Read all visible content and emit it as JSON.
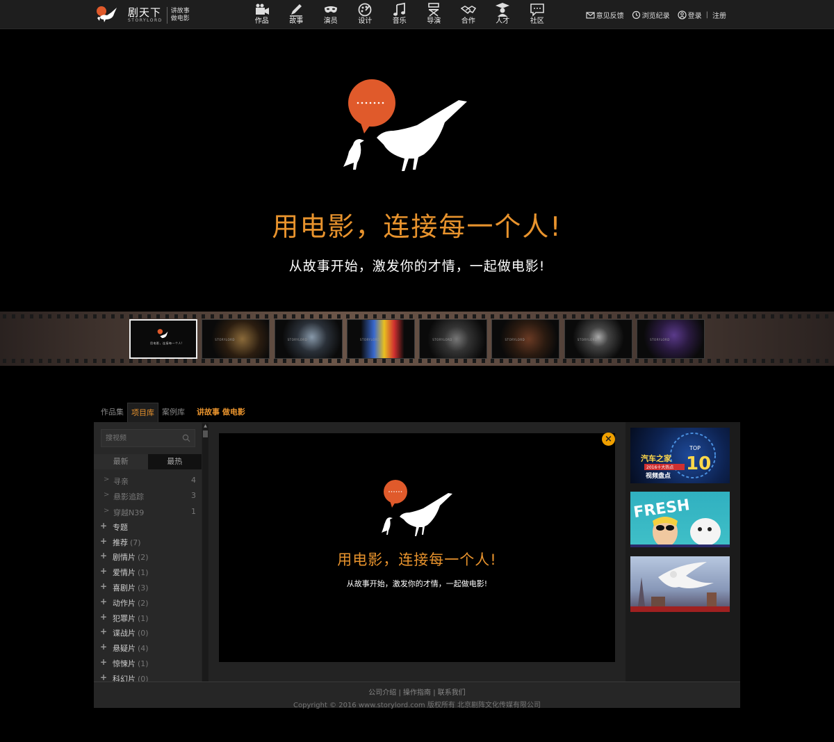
{
  "logo": {
    "cn": "剧天下",
    "en": "STORYLORD",
    "slogan_line1": "讲故事",
    "slogan_line2": "做电影"
  },
  "nav": [
    {
      "label": "作品",
      "icon": "video-camera-icon"
    },
    {
      "label": "故事",
      "icon": "pencil-icon"
    },
    {
      "label": "演员",
      "icon": "mask-icon"
    },
    {
      "label": "设计",
      "icon": "palette-icon"
    },
    {
      "label": "音乐",
      "icon": "music-note-icon"
    },
    {
      "label": "导演",
      "icon": "director-chair-icon"
    },
    {
      "label": "合作",
      "icon": "handshake-icon"
    },
    {
      "label": "人才",
      "icon": "graduate-icon"
    },
    {
      "label": "社区",
      "icon": "chat-bubble-icon"
    }
  ],
  "rightnav": {
    "feedback": "意见反馈",
    "history": "浏览纪录",
    "login": "登录",
    "sep": "|",
    "register": "注册"
  },
  "hero": {
    "title": "用电影，连接每一个人!",
    "subtitle": "从故事开始，激发你的才情，一起做电影!"
  },
  "filmstrip": {
    "frame_texts": [
      "用电影，连接每一个人!",
      "STORYLORD",
      "STORYLORD",
      "STORYLORD",
      "STORYLORD",
      "STORYLORD",
      "STORYLORD",
      "STORYLORD"
    ]
  },
  "tabs": {
    "items": [
      "作品集",
      "项目库",
      "案例库"
    ],
    "active": 1,
    "slogan": "讲故事 做电影"
  },
  "search": {
    "placeholder": "搜视频"
  },
  "sort": {
    "newest": "最新",
    "hottest": "最热"
  },
  "subitems": [
    {
      "name": "寻亲",
      "count": "4"
    },
    {
      "name": "悬影追踪",
      "count": "3"
    },
    {
      "name": "穿越N39",
      "count": "1"
    }
  ],
  "categories": [
    {
      "name": "专题",
      "count": ""
    },
    {
      "name": "推荐",
      "count": "(7)"
    },
    {
      "name": "剧情片",
      "count": "(2)"
    },
    {
      "name": "爱情片",
      "count": "(1)"
    },
    {
      "name": "喜剧片",
      "count": "(3)"
    },
    {
      "name": "动作片",
      "count": "(2)"
    },
    {
      "name": "犯罪片",
      "count": "(1)"
    },
    {
      "name": "谍战片",
      "count": "(0)"
    },
    {
      "name": "悬疑片",
      "count": "(4)"
    },
    {
      "name": "惊悚片",
      "count": "(1)"
    },
    {
      "name": "科幻片",
      "count": "(0)"
    }
  ],
  "preview": {
    "title": "用电影，连接每一个人!",
    "subtitle": "从故事开始，激发你的才情，一起做电影!",
    "close": "×"
  },
  "thumbs": {
    "t1_line1": "汽车之家",
    "t1_line2": "2016十大热点",
    "t1_line3": "视频盘点",
    "t1_top": "TOP",
    "t1_num": "10",
    "t2_text": "FRESH"
  },
  "footer": {
    "links": [
      "公司介绍",
      "操作指南",
      "联系我们"
    ],
    "sep": "|",
    "copyright": "Copyright © 2016 www.storylord.com 版权所有 北京剧阵文化传媒有限公司"
  },
  "colors": {
    "accent": "#e8932d",
    "brand_orange": "#e05a2b",
    "close": "#f0a000",
    "bg": "#000000",
    "panel": "#232323"
  }
}
